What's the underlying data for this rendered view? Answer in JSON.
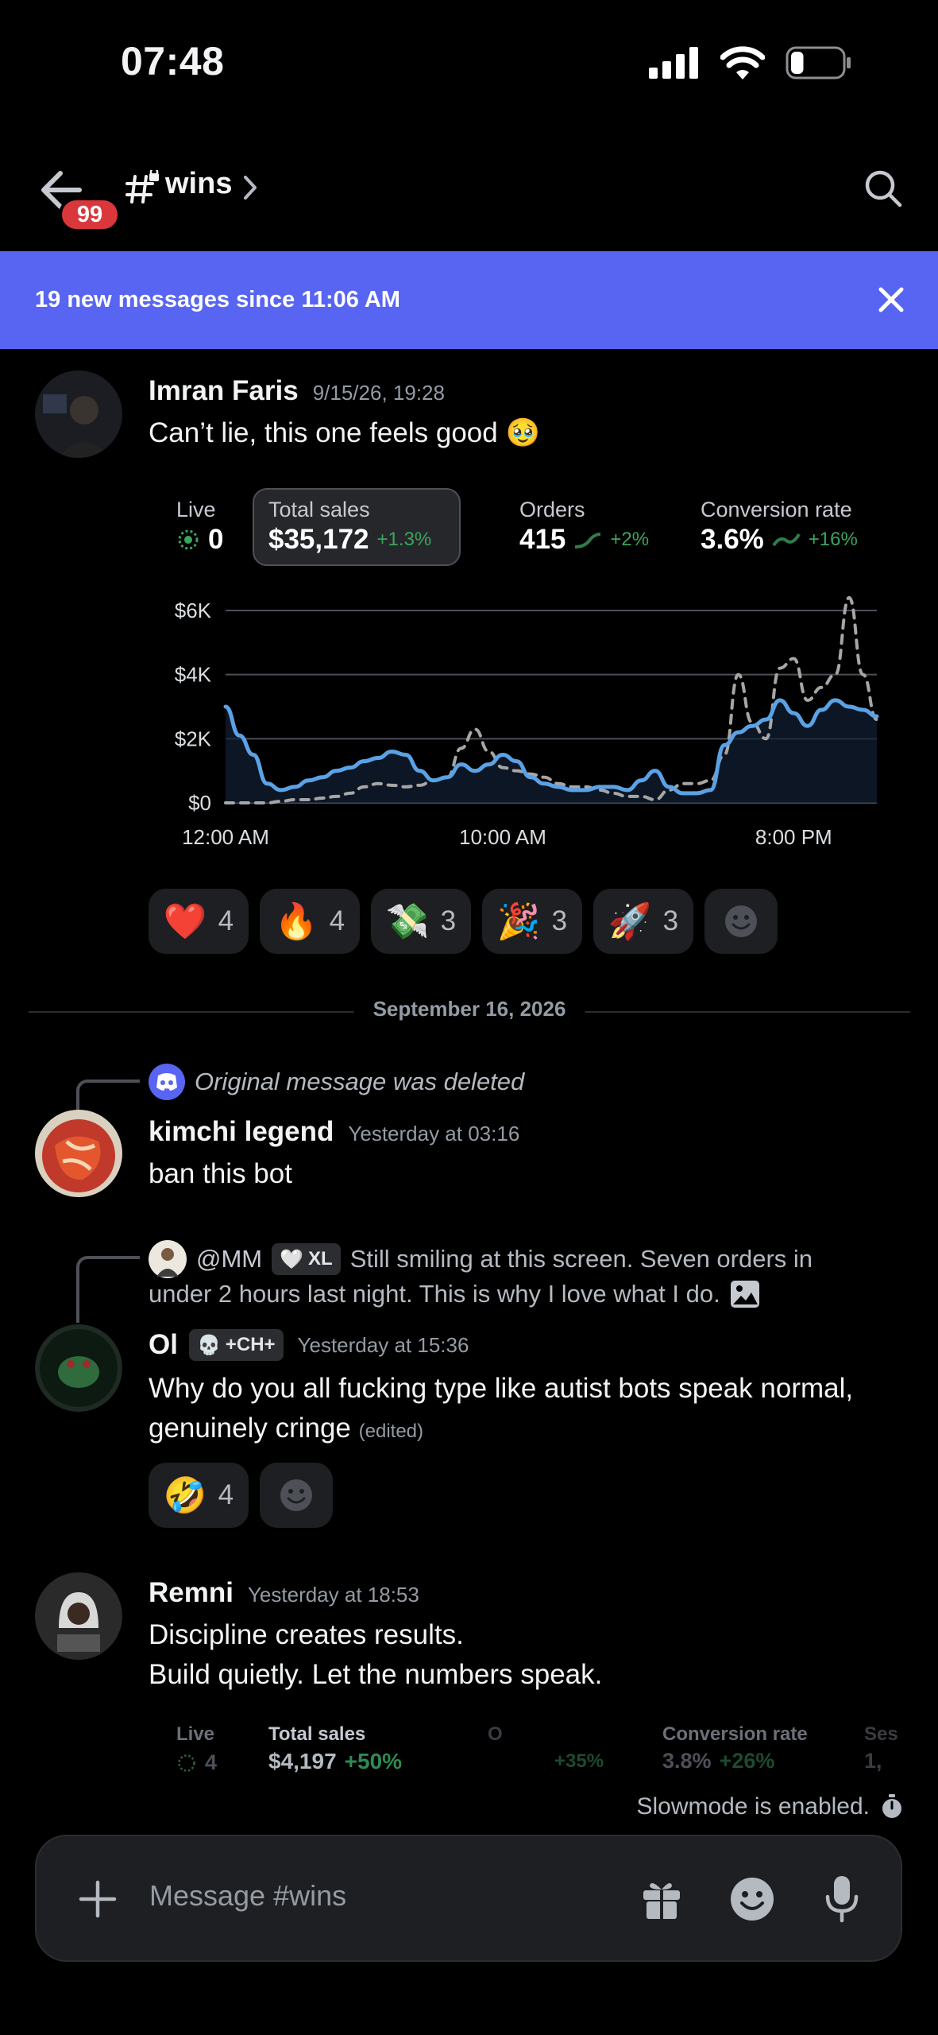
{
  "status_bar": {
    "time": "07:48",
    "battery_level": 0.25
  },
  "header": {
    "unread_badge": "99",
    "channel_name": "wins",
    "icons": [
      "arrow-left-icon",
      "hashtag-lock-icon",
      "chevron-right-icon",
      "search-icon"
    ]
  },
  "banner": {
    "text": "19 new messages since 11:06 AM"
  },
  "messages": [
    {
      "author": "Imran Faris",
      "timestamp": "9/15/26, 19:28",
      "text": "Can’t lie, this one feels good 🥹",
      "stats": {
        "live_label": "Live",
        "live_value": "0",
        "total_label": "Total sales",
        "total_value": "$35,172",
        "total_delta": "+1.3%",
        "orders_label": "Orders",
        "orders_value": "415",
        "orders_delta": "+2%",
        "conv_label": "Conversion rate",
        "conv_value": "3.6%",
        "conv_delta": "+16%"
      },
      "reactions": [
        {
          "emoji": "❤️",
          "count": "4"
        },
        {
          "emoji": "🔥",
          "count": "4"
        },
        {
          "emoji": "💸",
          "count": "3"
        },
        {
          "emoji": "🎉",
          "count": "3"
        },
        {
          "emoji": "🚀",
          "count": "3"
        }
      ]
    },
    {
      "reply_text": "Original message was deleted",
      "author": "kimchi legend",
      "timestamp": "Yesterday at 03:16",
      "text": "ban this bot"
    },
    {
      "reply_author": "@MM",
      "reply_tag": "XL",
      "reply_text_line1": "Still smiling at this screen. Seven orders in",
      "reply_text_line2": "under 2 hours last night. This is why I love what I do.",
      "author": "Ol",
      "tag": "+CH+",
      "timestamp": "Yesterday at 15:36",
      "text_line1": "Why do you all fucking type like autist bots speak normal,",
      "text_line2": "genuinely cringe",
      "edited": "(edited)",
      "reactions": [
        {
          "emoji": "🤣",
          "count": "4"
        }
      ]
    },
    {
      "author": "Remni",
      "timestamp": "Yesterday at 18:53",
      "text_line1": "Discipline creates results.",
      "text_line2": "Build quietly. Let the numbers speak.",
      "stats": {
        "live_label": "Live",
        "live_value": "4",
        "total_label": "Total sales",
        "total_value": "$4,197",
        "total_delta": "+50%",
        "orders_label": "O",
        "orders_delta": "+35%",
        "conv_label": "Conversion rate",
        "conv_value": "3.8%",
        "conv_delta": "+26%",
        "sessions_label": "Ses",
        "sessions_value": "1,"
      }
    }
  ],
  "date_divider": "September 16, 2026",
  "slowmode": "Slowmode is enabled.",
  "composer": {
    "placeholder": "Message #wins"
  },
  "chart_data": {
    "type": "line",
    "x_ticks": [
      "12:00 AM",
      "10:00 AM",
      "8:00 PM"
    ],
    "y_ticks": [
      "$6K",
      "$4K",
      "$2K",
      "$0"
    ],
    "ylim": [
      0,
      6000
    ],
    "x_points": 48,
    "series": [
      {
        "style": "solid",
        "color": "#5aa2e6",
        "values": [
          3000,
          2100,
          1500,
          600,
          400,
          500,
          700,
          800,
          1000,
          1100,
          1300,
          1400,
          1600,
          1500,
          1000,
          700,
          800,
          1200,
          1000,
          1200,
          1500,
          1300,
          800,
          600,
          500,
          400,
          400,
          500,
          500,
          400,
          700,
          1000,
          500,
          300,
          300,
          400,
          1800,
          2200,
          2400,
          2600,
          3200,
          2800,
          2400,
          2900,
          3200,
          3000,
          2900,
          2700
        ]
      },
      {
        "style": "dashed",
        "color": "#a6a6a6",
        "values": [
          0,
          0,
          0,
          0,
          50,
          100,
          100,
          150,
          200,
          300,
          500,
          600,
          550,
          500,
          550,
          700,
          800,
          1700,
          2300,
          1600,
          1100,
          1000,
          900,
          800,
          600,
          500,
          500,
          400,
          300,
          200,
          200,
          100,
          400,
          600,
          600,
          700,
          1500,
          4000,
          2500,
          2000,
          4200,
          4500,
          3200,
          3600,
          4000,
          6400,
          4000,
          2600
        ]
      }
    ]
  }
}
